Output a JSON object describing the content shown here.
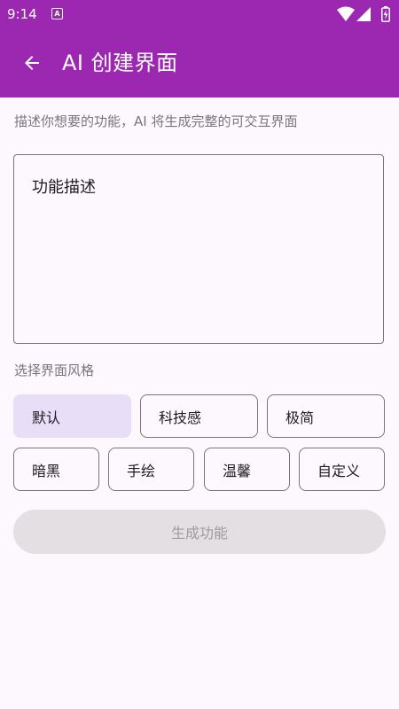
{
  "status_bar": {
    "time": "9:14",
    "notification_glyph": "A",
    "icons": [
      "wifi-icon",
      "signal-icon",
      "battery-charging-icon"
    ]
  },
  "app_bar": {
    "title": "AI 创建界面",
    "back_icon": "arrow-back-icon",
    "background_color": "#9C27B0"
  },
  "form": {
    "subtitle": "描述你想要的功能，AI 将生成完整的可交互界面",
    "description_placeholder": "功能描述",
    "description_value": "",
    "style_label": "选择界面风格",
    "styles": [
      {
        "label": "默认",
        "selected": true
      },
      {
        "label": "科技感",
        "selected": false
      },
      {
        "label": "极简",
        "selected": false
      },
      {
        "label": "暗黑",
        "selected": false
      },
      {
        "label": "手绘",
        "selected": false
      },
      {
        "label": "温馨",
        "selected": false
      },
      {
        "label": "自定义",
        "selected": false
      }
    ],
    "generate_label": "生成功能",
    "generate_enabled": false
  },
  "colors": {
    "accent": "#9C27B0",
    "chip_selected": "#E8DEF8",
    "outline": "#79747E",
    "disabled_button": "#E3DFE3",
    "disabled_text": "#9E9A9F",
    "background": "#FDF8FD"
  }
}
